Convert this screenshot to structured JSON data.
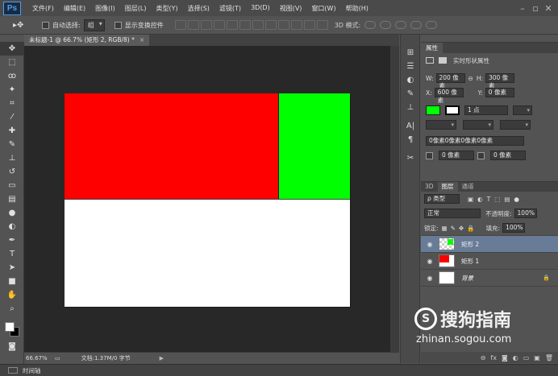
{
  "app": {
    "logo": "Ps"
  },
  "menu": [
    "文件(F)",
    "编辑(E)",
    "图像(I)",
    "图层(L)",
    "类型(Y)",
    "选择(S)",
    "滤镜(T)",
    "3D(D)",
    "视图(V)",
    "窗口(W)",
    "帮助(H)"
  ],
  "options": {
    "auto_select_label": "自动选择:",
    "auto_select_value": "组",
    "show_transform_label": "显示变换控件",
    "mode_3d_label": "3D 模式:"
  },
  "document": {
    "tab_title": "未标题-1 @ 66.7% (矩形 2, RGB/8) *",
    "zoom": "66.67%",
    "doc_info": "文档:1.37M/0 字节"
  },
  "canvas_colors": {
    "red_rect": "#ff0000",
    "green_rect": "#00ff00",
    "background": "#ffffff"
  },
  "timeline": {
    "label": "时间轴"
  },
  "properties": {
    "tab": "属性",
    "title": "实时形状属性",
    "w_label": "W:",
    "w_value": "200 像素",
    "h_label": "H:",
    "h_value": "300 像素",
    "x_label": "X:",
    "x_value": "600 像素",
    "y_label": "Y:",
    "y_value": "0 像素",
    "stroke_width": "1 点",
    "corner_all": "0像素0像素0像素0像素",
    "corner_a": "0 像素",
    "corner_b": "0 像素"
  },
  "layers_panel": {
    "tabs": [
      "3D",
      "图层",
      "通道"
    ],
    "kind_label": "ρ 类型",
    "blend_mode": "正常",
    "opacity_label": "不透明度:",
    "opacity_value": "100%",
    "lock_label": "锁定:",
    "fill_label": "填充:",
    "fill_value": "100%",
    "layers": [
      {
        "name": "矩形 2",
        "selected": true
      },
      {
        "name": "矩形 1",
        "selected": false
      },
      {
        "name": "背景",
        "selected": false
      }
    ]
  },
  "watermark": {
    "text": "搜狗指南",
    "url": "zhinan.sogou.com"
  }
}
